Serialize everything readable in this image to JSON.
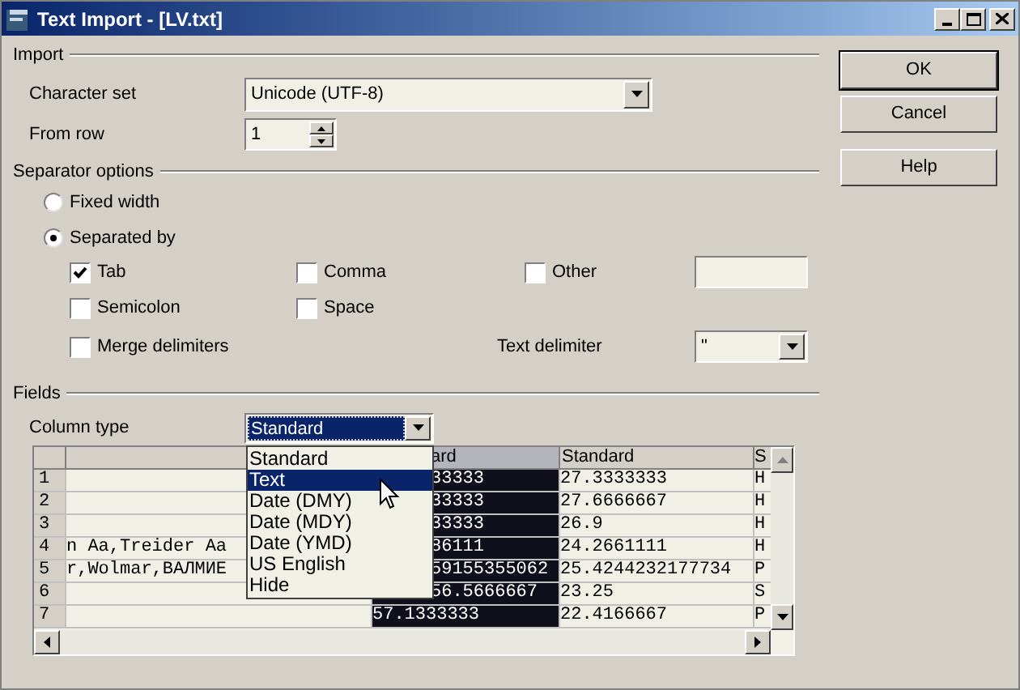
{
  "window": {
    "title": "Text Import - [LV.txt]"
  },
  "import": {
    "title": "Import",
    "character_set": {
      "label": "Character set",
      "value": "Unicode (UTF-8)"
    },
    "from_row": {
      "label": "From row",
      "value": "1"
    }
  },
  "separator_options": {
    "title": "Separator options",
    "modes": [
      {
        "label": "Fixed width",
        "selected": false
      },
      {
        "label": "Separated by",
        "selected": true
      }
    ],
    "separators": [
      {
        "label": "Tab",
        "checked": true
      },
      {
        "label": "Comma",
        "checked": false
      },
      {
        "label": "Other",
        "checked": false
      },
      {
        "label": "Semicolon",
        "checked": false
      },
      {
        "label": "Space",
        "checked": false
      }
    ],
    "merge_delimiters": {
      "label": "Merge delimiters",
      "checked": false
    },
    "text_delimiter": {
      "label": "Text delimiter",
      "value": "\""
    }
  },
  "fields": {
    "title": "Fields",
    "column_type": {
      "label": "Column type",
      "value": "Standard",
      "options": [
        {
          "label": "Standard",
          "highlighted": false
        },
        {
          "label": "Text",
          "highlighted": true
        },
        {
          "label": "Date (DMY)",
          "highlighted": false
        },
        {
          "label": "Date (MDY)",
          "highlighted": false
        },
        {
          "label": "Date (YMD)",
          "highlighted": false
        },
        {
          "label": "US English",
          "highlighted": false
        },
        {
          "label": "Hide",
          "highlighted": false
        }
      ]
    },
    "grid": {
      "headers": {
        "column_2": "ard",
        "column_3": "Standard",
        "column_4": "S"
      },
      "rows": [
        {
          "number": "1",
          "column_2": "33333",
          "column_3": "27.3333333",
          "column_4": "H"
        },
        {
          "number": "2",
          "column_2": "33333",
          "column_3": "27.6666667",
          "column_4": "H"
        },
        {
          "number": "3",
          "column_2": "33333",
          "column_3": "26.9",
          "column_4": "H"
        },
        {
          "number": "4",
          "column_1": "n Aa,Treider Aa",
          "column_2": "86111",
          "column_3": "24.2661111",
          "column_4": "H"
        },
        {
          "number": "5",
          "column_1": "r,Wolmar,ВАЛМИЕ",
          "column_2": "59155355062",
          "column_3": "25.4244232177734",
          "column_4": "P"
        },
        {
          "number": "6",
          "column_2": "56.5666667",
          "column_3": "23.25",
          "column_4": "S"
        },
        {
          "number": "7",
          "column_2": "57.1333333",
          "column_3": "22.4166667",
          "column_4": "P"
        }
      ]
    }
  },
  "buttons": [
    "OK",
    "Cancel",
    "Help"
  ]
}
